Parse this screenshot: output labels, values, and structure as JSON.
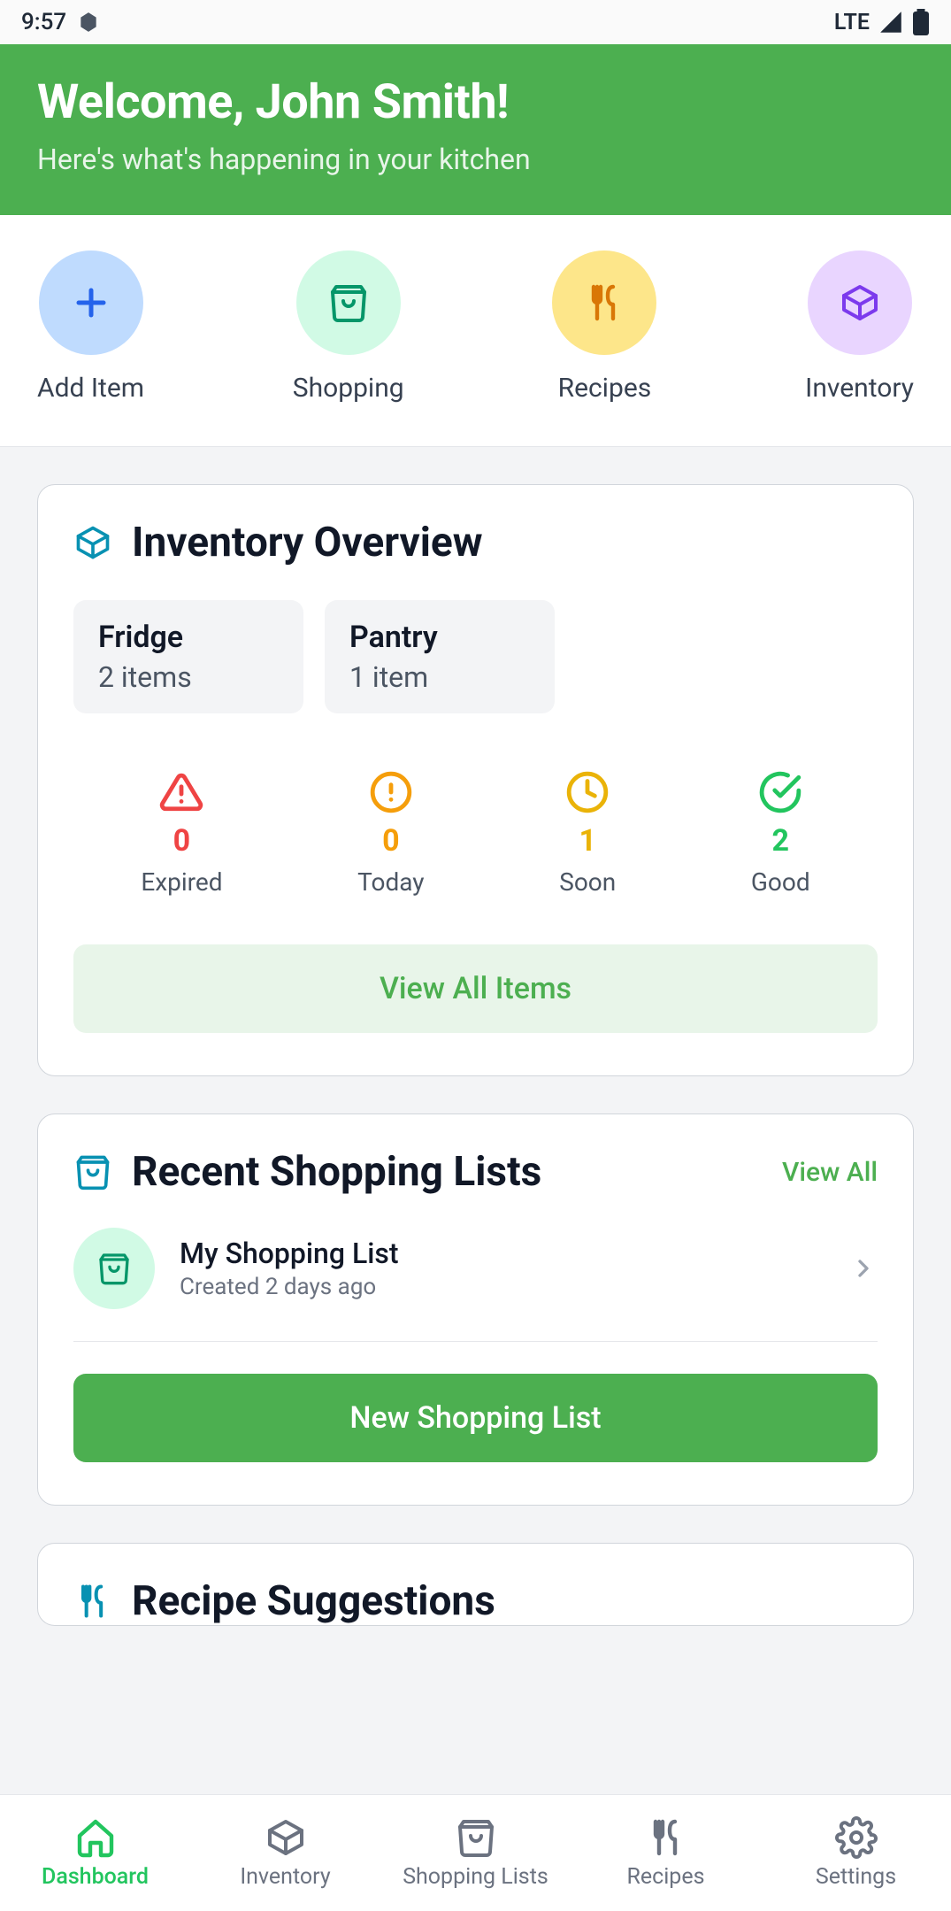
{
  "status_bar": {
    "time": "9:57",
    "network": "LTE"
  },
  "header": {
    "title": "Welcome, John Smith!",
    "subtitle": "Here's what's happening in your kitchen"
  },
  "quick_actions": {
    "add": {
      "label": "Add Item"
    },
    "shopping": {
      "label": "Shopping"
    },
    "recipes": {
      "label": "Recipes"
    },
    "inventory": {
      "label": "Inventory"
    }
  },
  "inventory_card": {
    "title": "Inventory Overview",
    "locations": {
      "fridge": {
        "name": "Fridge",
        "count": "2 items"
      },
      "pantry": {
        "name": "Pantry",
        "count": "1 item"
      }
    },
    "stats": {
      "expired": {
        "value": "0",
        "label": "Expired"
      },
      "today": {
        "value": "0",
        "label": "Today"
      },
      "soon": {
        "value": "1",
        "label": "Soon"
      },
      "good": {
        "value": "2",
        "label": "Good"
      }
    },
    "view_all_button": "View All Items"
  },
  "shopping_card": {
    "title": "Recent Shopping Lists",
    "view_all_link": "View All",
    "list": {
      "name": "My Shopping List",
      "subtitle": "Created 2 days ago"
    },
    "new_button": "New Shopping List"
  },
  "recipe_card": {
    "title": "Recipe Suggestions"
  },
  "bottom_nav": {
    "dashboard": "Dashboard",
    "inventory": "Inventory",
    "shopping": "Shopping Lists",
    "recipes": "Recipes",
    "settings": "Settings"
  }
}
